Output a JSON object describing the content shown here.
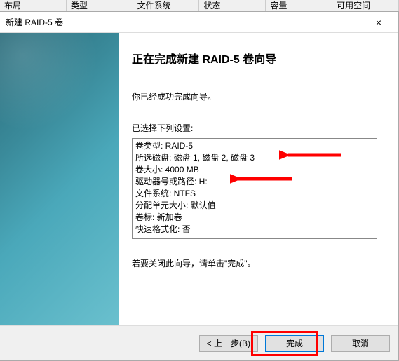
{
  "bg_columns": [
    "布局",
    "类型",
    "文件系统",
    "状态",
    "容量",
    "可用空间"
  ],
  "dialog": {
    "title": "新建 RAID-5 卷",
    "close": "×",
    "heading": "正在完成新建 RAID-5 卷向导",
    "success_msg": "你已经成功完成向导。",
    "selected_label": "已选择下列设置:",
    "close_hint": "若要关闭此向导，请单击\"完成\"。",
    "settings": [
      "卷类型: RAID-5",
      "所选磁盘: 磁盘 1, 磁盘 2, 磁盘 3",
      "卷大小: 4000 MB",
      "驱动器号或路径: H:",
      "文件系统: NTFS",
      "分配单元大小: 默认值",
      "卷标: 新加卷",
      "快速格式化: 否"
    ],
    "buttons": {
      "back": "< 上一步(B)",
      "finish": "完成",
      "cancel": "取消"
    }
  }
}
